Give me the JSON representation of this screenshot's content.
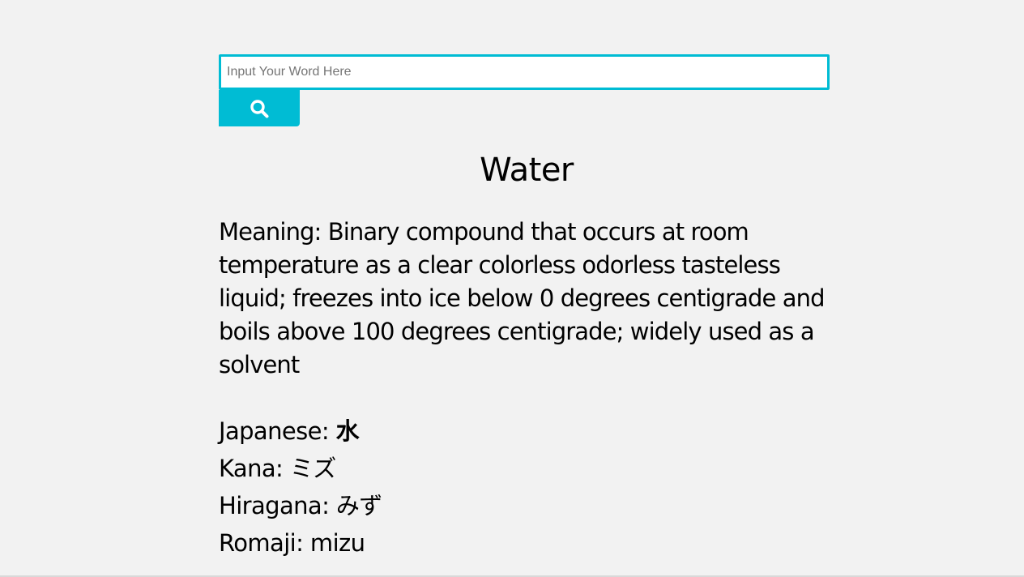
{
  "search": {
    "placeholder": "Input Your Word Here",
    "value": "",
    "button_icon": "search-icon"
  },
  "result": {
    "word": "Water",
    "meaning_label": "Meaning:",
    "meaning_text": "Binary compound that occurs at room temperature as a clear colorless odorless tasteless liquid; freezes into ice below 0 degrees centigrade and boils above 100 degrees centigrade; widely used as a solvent",
    "readings": [
      {
        "label": "Japanese:",
        "value": "水"
      },
      {
        "label": "Kana:",
        "value": "ミズ"
      },
      {
        "label": "Hiragana:",
        "value": "みず"
      },
      {
        "label": "Romaji:",
        "value": "mizu"
      }
    ]
  },
  "colors": {
    "accent": "#00bcd4",
    "background": "#f2f2f2"
  }
}
